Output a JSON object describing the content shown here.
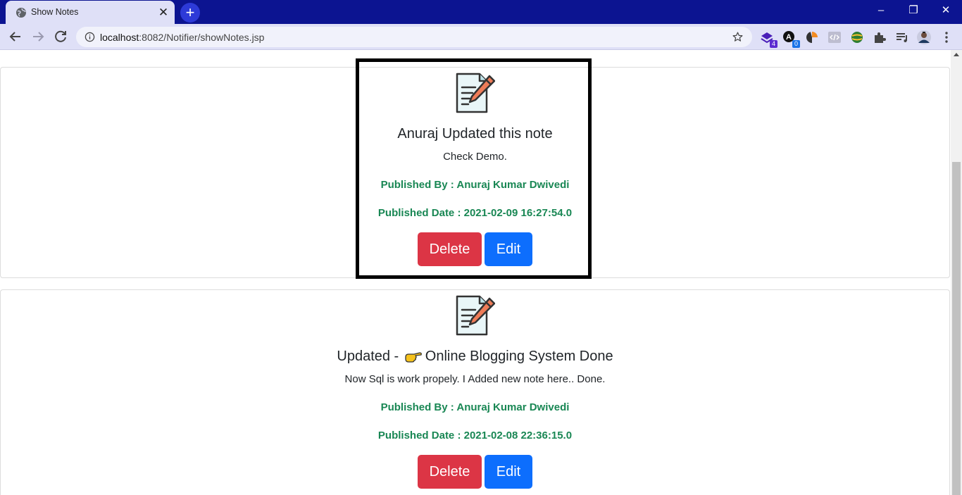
{
  "browser": {
    "tab_title": "Show Notes",
    "tab_close": "✕",
    "new_tab": "+",
    "url_host": "localhost",
    "url_rest": ":8082/Notifier/showNotes.jsp",
    "window_controls": {
      "minimize": "–",
      "restore": "❐",
      "close": "✕"
    },
    "extensions": [
      {
        "name": "stack-extension-icon",
        "badge": "4",
        "badge_color": "#5b2bd1"
      },
      {
        "name": "grammar-extension-icon",
        "badge": "0",
        "badge_color": "#1a73e8"
      },
      {
        "name": "slice-extension-icon",
        "badge": ""
      },
      {
        "name": "code-extension-icon",
        "badge": ""
      },
      {
        "name": "globe-extension-icon",
        "badge": ""
      },
      {
        "name": "puzzle-icon",
        "badge": ""
      },
      {
        "name": "media-queue-icon",
        "badge": ""
      },
      {
        "name": "profile-avatar",
        "badge": ""
      },
      {
        "name": "kebab-menu-icon",
        "badge": ""
      }
    ]
  },
  "notes": [
    {
      "title": "Anuraj Updated this note",
      "content": "Check Demo.",
      "published_by": "Published By : Anuraj Kumar Dwivedi",
      "published_date": "Published Date : 2021-02-09 16:27:54.0",
      "delete_label": "Delete",
      "edit_label": "Edit"
    },
    {
      "title_prefix": "Updated -",
      "title_suffix": "Online Blogging System Done",
      "content": "Now Sql is work propely. I Added new note here.. Done.",
      "published_by": "Published By : Anuraj Kumar Dwivedi",
      "published_date": "Published Date : 2021-02-08 22:36:15.0",
      "delete_label": "Delete",
      "edit_label": "Edit"
    }
  ],
  "colors": {
    "titlebar": "#0c1491",
    "toolbar": "#dfe0f7",
    "meta_text": "#198754",
    "delete_button": "#dc3545",
    "edit_button": "#0d6efd"
  }
}
